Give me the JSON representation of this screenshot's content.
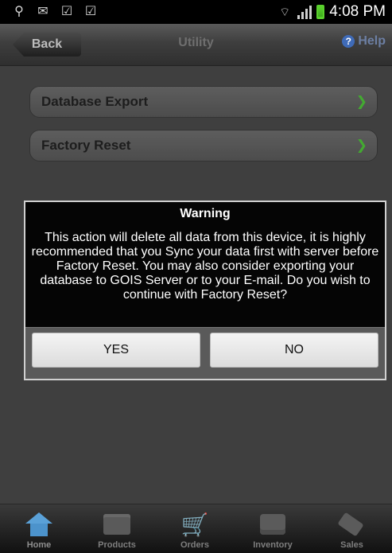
{
  "status_bar": {
    "time": "4:08 PM",
    "icons": [
      "usb-icon",
      "mail-icon",
      "check-icon",
      "check-icon",
      "wifi-icon",
      "signal-icon",
      "battery-icon"
    ]
  },
  "header": {
    "back_label": "Back",
    "title": "Utility",
    "help_label": "Help"
  },
  "menu": [
    {
      "label": "Database Export"
    },
    {
      "label": "Factory Reset"
    }
  ],
  "dialog": {
    "title": "Warning",
    "message": "This action will delete all data from this device, it is highly recommended that you Sync your data first with server before Factory Reset. You may also consider exporting your database to GOIS Server or to your E-mail. Do you wish to continue with Factory Reset?",
    "yes_label": "YES",
    "no_label": "NO"
  },
  "tabs": [
    {
      "label": "Home",
      "icon": "home-icon"
    },
    {
      "label": "Products",
      "icon": "folder-icon"
    },
    {
      "label": "Orders",
      "icon": "cart-icon"
    },
    {
      "label": "Inventory",
      "icon": "inbox-icon"
    },
    {
      "label": "Sales",
      "icon": "tag-icon"
    }
  ],
  "colors": {
    "accent_green": "#4fc83a",
    "help_blue": "#3f6bb8",
    "home_blue": "#4c93cc"
  }
}
